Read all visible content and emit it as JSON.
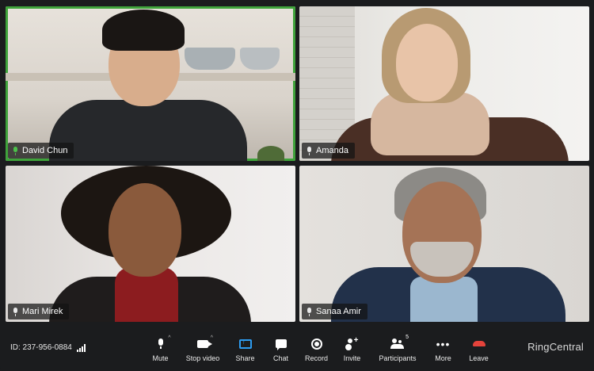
{
  "participants": [
    {
      "name": "David Chun",
      "speaking": true
    },
    {
      "name": "Amanda",
      "speaking": false
    },
    {
      "name": "Mari Mirek",
      "speaking": false
    },
    {
      "name": "Sanaa Amir",
      "speaking": false
    }
  ],
  "meeting": {
    "id_text": "ID: 237-956-0884"
  },
  "controls": {
    "mute": "Mute",
    "stop_video": "Stop video",
    "share": "Share",
    "chat": "Chat",
    "record": "Record",
    "invite": "Invite",
    "participants": "Participants",
    "participants_count": "5",
    "more": "More",
    "leave": "Leave"
  },
  "brand": "RingCentral",
  "colors": {
    "active_speaker": "#3fa33b",
    "share_icon": "#2d9cf0",
    "leave_icon": "#e5433b"
  },
  "icons": [
    "mic-icon",
    "camera-icon",
    "share-screen-icon",
    "chat-icon",
    "record-icon",
    "invite-icon",
    "participants-icon",
    "more-icon",
    "leave-phone-icon",
    "signal-icon"
  ]
}
